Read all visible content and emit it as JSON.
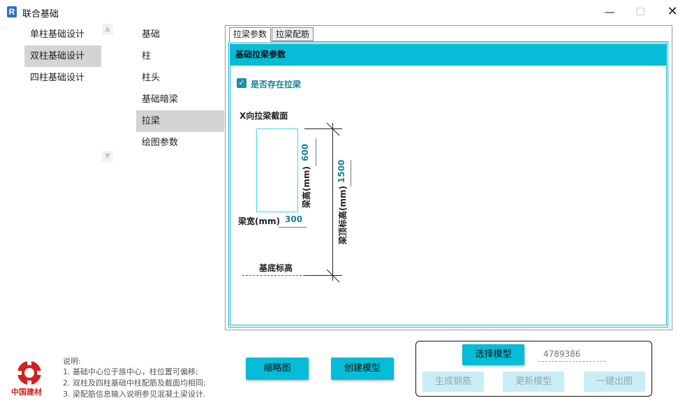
{
  "window": {
    "app_icon": "R",
    "title": "联合基础",
    "minimize": "—",
    "maximize": "☐",
    "close": "✕"
  },
  "left_nav": {
    "items": [
      {
        "label": "单柱基础设计"
      },
      {
        "label": "双柱基础设计"
      },
      {
        "label": "四柱基础设计"
      }
    ],
    "active_index": 1
  },
  "mid_nav": {
    "items": [
      {
        "label": "基础"
      },
      {
        "label": "柱"
      },
      {
        "label": "柱头"
      },
      {
        "label": "基础暗梁"
      },
      {
        "label": "拉梁"
      },
      {
        "label": "绘图参数"
      }
    ],
    "active_index": 4
  },
  "tabs": [
    {
      "label": "拉梁参数"
    },
    {
      "label": "拉梁配筋"
    }
  ],
  "panel": {
    "header": "基础拉梁参数",
    "checkbox_label": "是否存在拉梁",
    "checkbox_checked": true,
    "section_title": "X向拉梁截面",
    "beam_height_label": "梁高(mm)",
    "beam_height_value": "600",
    "beam_width_label": "梁宽(mm)",
    "beam_width_value": "300",
    "top_elev_label": "梁顶标高(mm)",
    "top_elev_value": "1500",
    "base_elev_label": "基底标高"
  },
  "notes": {
    "title": "说明:",
    "lines": [
      "1. 基础中心位于族中心，柱位置可偏移;",
      "2. 双柱及四柱基础中柱配筋及截面均相同;",
      "3. 梁配筋信息输入说明参见混凝土梁设计."
    ]
  },
  "logo": {
    "text": "中国建材"
  },
  "buttons": {
    "thumbnail": "缩略图",
    "create_model": "创建模型",
    "select_model": "选择模型",
    "gen_rebar": "生成钢筋",
    "update_model": "更新模型",
    "one_click_drawing": "一键出图"
  },
  "model_id": "4789386",
  "colors": {
    "accent": "#06bcd6",
    "teal_text": "#1a7f95",
    "logo_red": "#d42020"
  }
}
